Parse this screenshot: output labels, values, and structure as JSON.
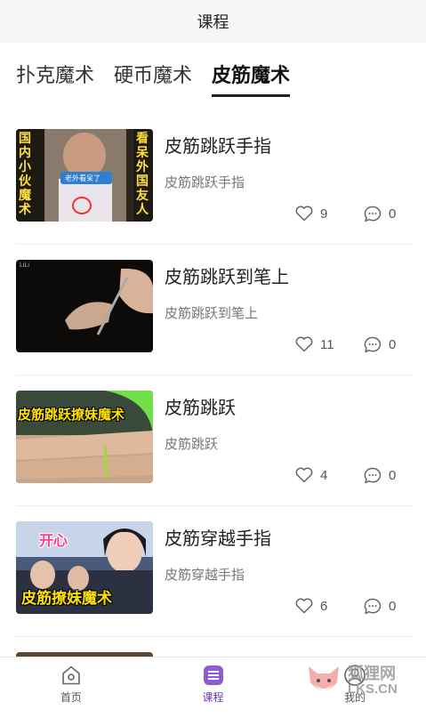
{
  "header": {
    "title": "课程"
  },
  "tabs": [
    {
      "label": "扑克魔术",
      "active": false
    },
    {
      "label": "硬币魔术",
      "active": false
    },
    {
      "label": "皮筋魔术",
      "active": true
    }
  ],
  "courses": [
    {
      "title": "皮筋跳跃手指",
      "subtitle": "皮筋跳跃手指",
      "likes": "9",
      "comments": "0",
      "thumb": {
        "left_text": "国内小伙魔术",
        "right_text": "看呆外国友人",
        "caption": "老外看呆了"
      }
    },
    {
      "title": "皮筋跳跃到笔上",
      "subtitle": "皮筋跳跃到笔上",
      "likes": "11",
      "comments": "0",
      "thumb": {
        "mark": "LiLi"
      }
    },
    {
      "title": "皮筋跳跃",
      "subtitle": "皮筋跳跃",
      "likes": "4",
      "comments": "0",
      "thumb": {
        "caption": "皮筋跳跃撩妹魔术"
      }
    },
    {
      "title": "皮筋穿越手指",
      "subtitle": "皮筋穿越手指",
      "likes": "6",
      "comments": "0",
      "thumb": {
        "top_text": "开心",
        "caption": "皮筋撩妹魔术"
      }
    }
  ],
  "bottom_nav": [
    {
      "label": "首页",
      "icon": "home-icon",
      "active": false
    },
    {
      "label": "课程",
      "icon": "course-icon",
      "active": true
    },
    {
      "label": "我的",
      "icon": "user-icon",
      "active": false
    }
  ],
  "watermark": {
    "line1": "狐狸网",
    "line2": "LKS.CN"
  },
  "colors": {
    "accent": "#8e5bd0",
    "header_bg": "#f6f6f6"
  }
}
